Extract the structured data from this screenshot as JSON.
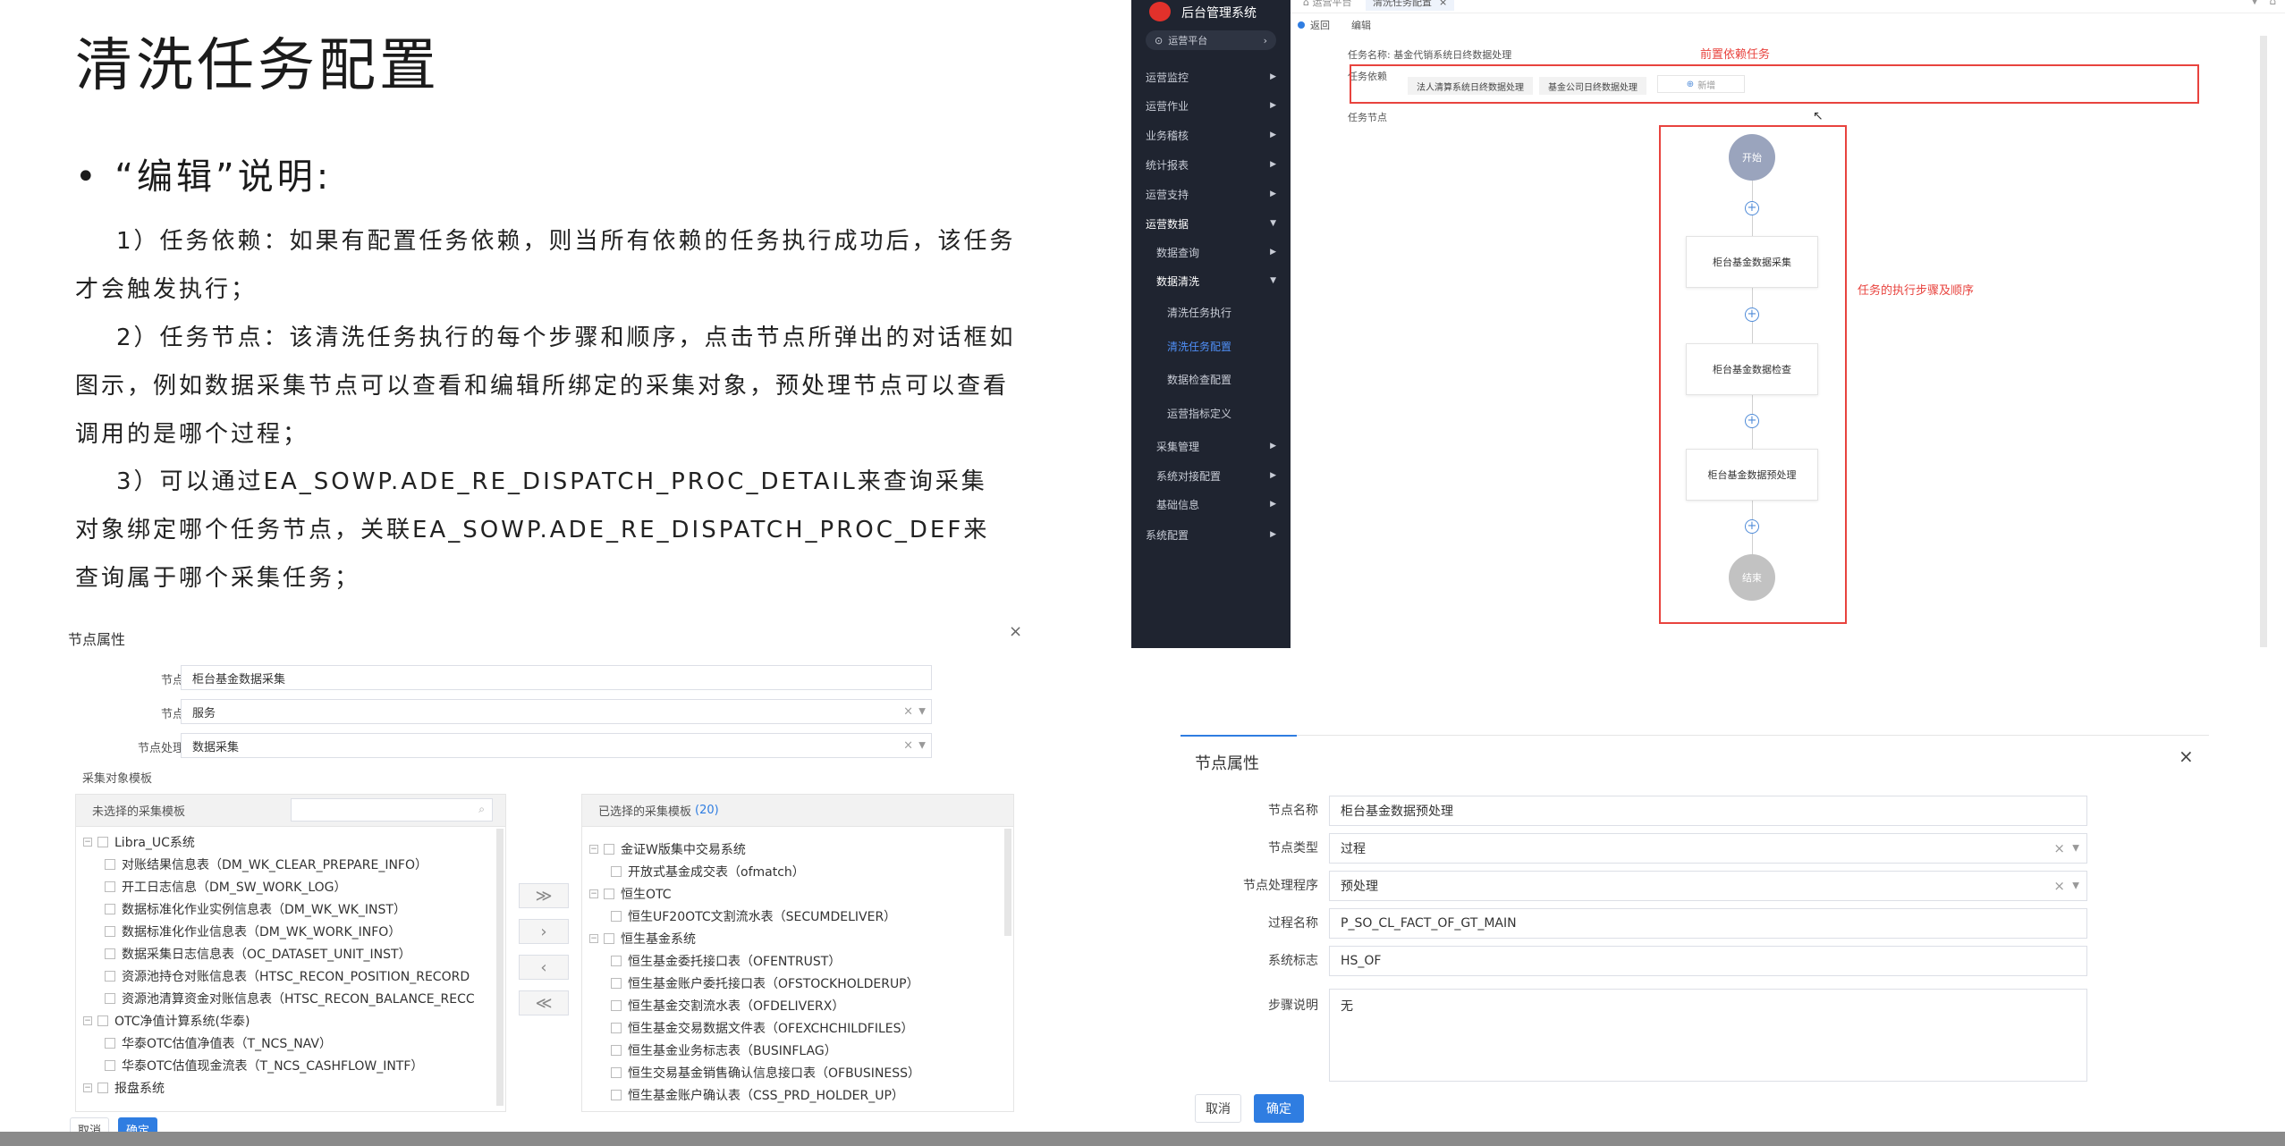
{
  "slide": {
    "title": "清洗任务配置",
    "bullet": "•  “编辑”说明:",
    "p1_a": "1）任务依赖：如果有配置任务依赖，则当所有依赖的任务执行成功后，该任务",
    "p1_b": "才会触发执行；",
    "p2_a": "2）任务节点：该清洗任务执行的每个步骤和顺序，点击节点所弹出的对话框如",
    "p2_b": "图示，例如数据采集节点可以查看和编辑所绑定的采集对象，预处理节点可以查看",
    "p2_c": "调用的是哪个过程；",
    "p3_a": "3）可以通过EA_SOWP.ADE_RE_DISPATCH_PROC_DETAIL来查询采集",
    "p3_b": "对象绑定哪个任务节点，关联EA_SOWP.ADE_RE_DISPATCH_PROC_DEF来",
    "p3_c": "查询属于哪个采集任务；"
  },
  "left_dialog": {
    "title": "节点属性",
    "close": "×",
    "name_label": "节点名称",
    "name_value": "柜台基金数据采集",
    "type_label": "节点类型",
    "type_value": "服务",
    "handler_label": "节点处理程序",
    "handler_value": "数据采集",
    "template_label": "采集对象模板",
    "left_panel_title": "未选择的采集模板",
    "right_panel_title": "已选择的采集模板",
    "right_panel_count": "(20)",
    "left_tree": [
      "Libra_UC系统",
      "对账结果信息表（DM_WK_CLEAR_PREPARE_INFO）",
      "开工日志信息（DM_SW_WORK_LOG）",
      "数据标准化作业实例信息表（DM_WK_WK_INST）",
      "数据标准化作业信息表（DM_WK_WORK_INFO）",
      "数据采集日志信息表（OC_DATASET_UNIT_INST）",
      "资源池持仓对账信息表（HTSC_RECON_POSITION_RECORD",
      "资源池清算资金对账信息表（HTSC_RECON_BALANCE_RECC",
      "OTC净值计算系统(华泰)",
      "华泰OTC估值净值表（T_NCS_NAV）",
      "华泰OTC估值现金流表（T_NCS_CASHFLOW_INTF）",
      "报盘系统"
    ],
    "right_tree": [
      "金证W版集中交易系统",
      "开放式基金成交表（ofmatch）",
      "恒生OTC",
      "恒生UF20OTC文割流水表（SECUMDELIVER）",
      "恒生基金系统",
      "恒生基金委托接口表（OFENTRUST）",
      "恒生基金账户委托接口表（OFSTOCKHOLDERUP）",
      "恒生基金交割流水表（OFDELIVERX）",
      "恒生基金交易数据文件表（OFEXCHCHILDFILES）",
      "恒生基金业务标志表（BUSINFLAG）",
      "恒生交易基金销售确认信息接口表（OFBUSINESS）",
      "恒生基金账户确认表（CSS_PRD_HOLDER_UP）"
    ],
    "cancel": "取消",
    "ok": "确定"
  },
  "admin": {
    "brand": "后台管理系统",
    "platform": "运营平台",
    "menu": [
      "运营监控",
      "运营作业",
      "业务稽核",
      "统计报表",
      "运营支持",
      "运营数据",
      "数据查询",
      "数据清洗",
      "清洗任务执行",
      "清洗任务配置",
      "数据检查配置",
      "运营指标定义",
      "采集管理",
      "系统对接配置",
      "基础信息",
      "系统配置"
    ],
    "tab_home": "运营平台",
    "tab_active": "清洗任务配置",
    "back": "返回",
    "edit": "编辑",
    "task_name_label": "任务名称:",
    "task_name_value": "基金代销系统日终数据处理",
    "dep_label": "任务依赖",
    "dep1": "法人清算系统日终数据处理",
    "dep2": "基金公司日终数据处理",
    "dep_add": "新增",
    "node_label": "任务节点",
    "ann_dep": "前置依赖任务",
    "ann_flow": "任务的执行步骤及顺序",
    "flow_start": "开始",
    "flow_nodes": [
      "柜台基金数据采集",
      "柜台基金数据检查",
      "柜台基金数据预处理"
    ],
    "flow_end": "结束"
  },
  "right_dialog": {
    "title": "节点属性",
    "close": "×",
    "name_label": "节点名称",
    "name_value": "柜台基金数据预处理",
    "type_label": "节点类型",
    "type_value": "过程",
    "handler_label": "节点处理程序",
    "handler_value": "预处理",
    "proc_label": "过程名称",
    "proc_value": "P_SO_CL_FACT_OF_GT_MAIN",
    "sys_label": "系统标志",
    "sys_value": "HS_OF",
    "desc_label": "步骤说明",
    "desc_value": "无",
    "cancel": "取消",
    "ok": "确定"
  },
  "colors": {
    "accent": "#2f7de1",
    "annotation": "#e8433e",
    "sidebar": "#1f2430"
  }
}
